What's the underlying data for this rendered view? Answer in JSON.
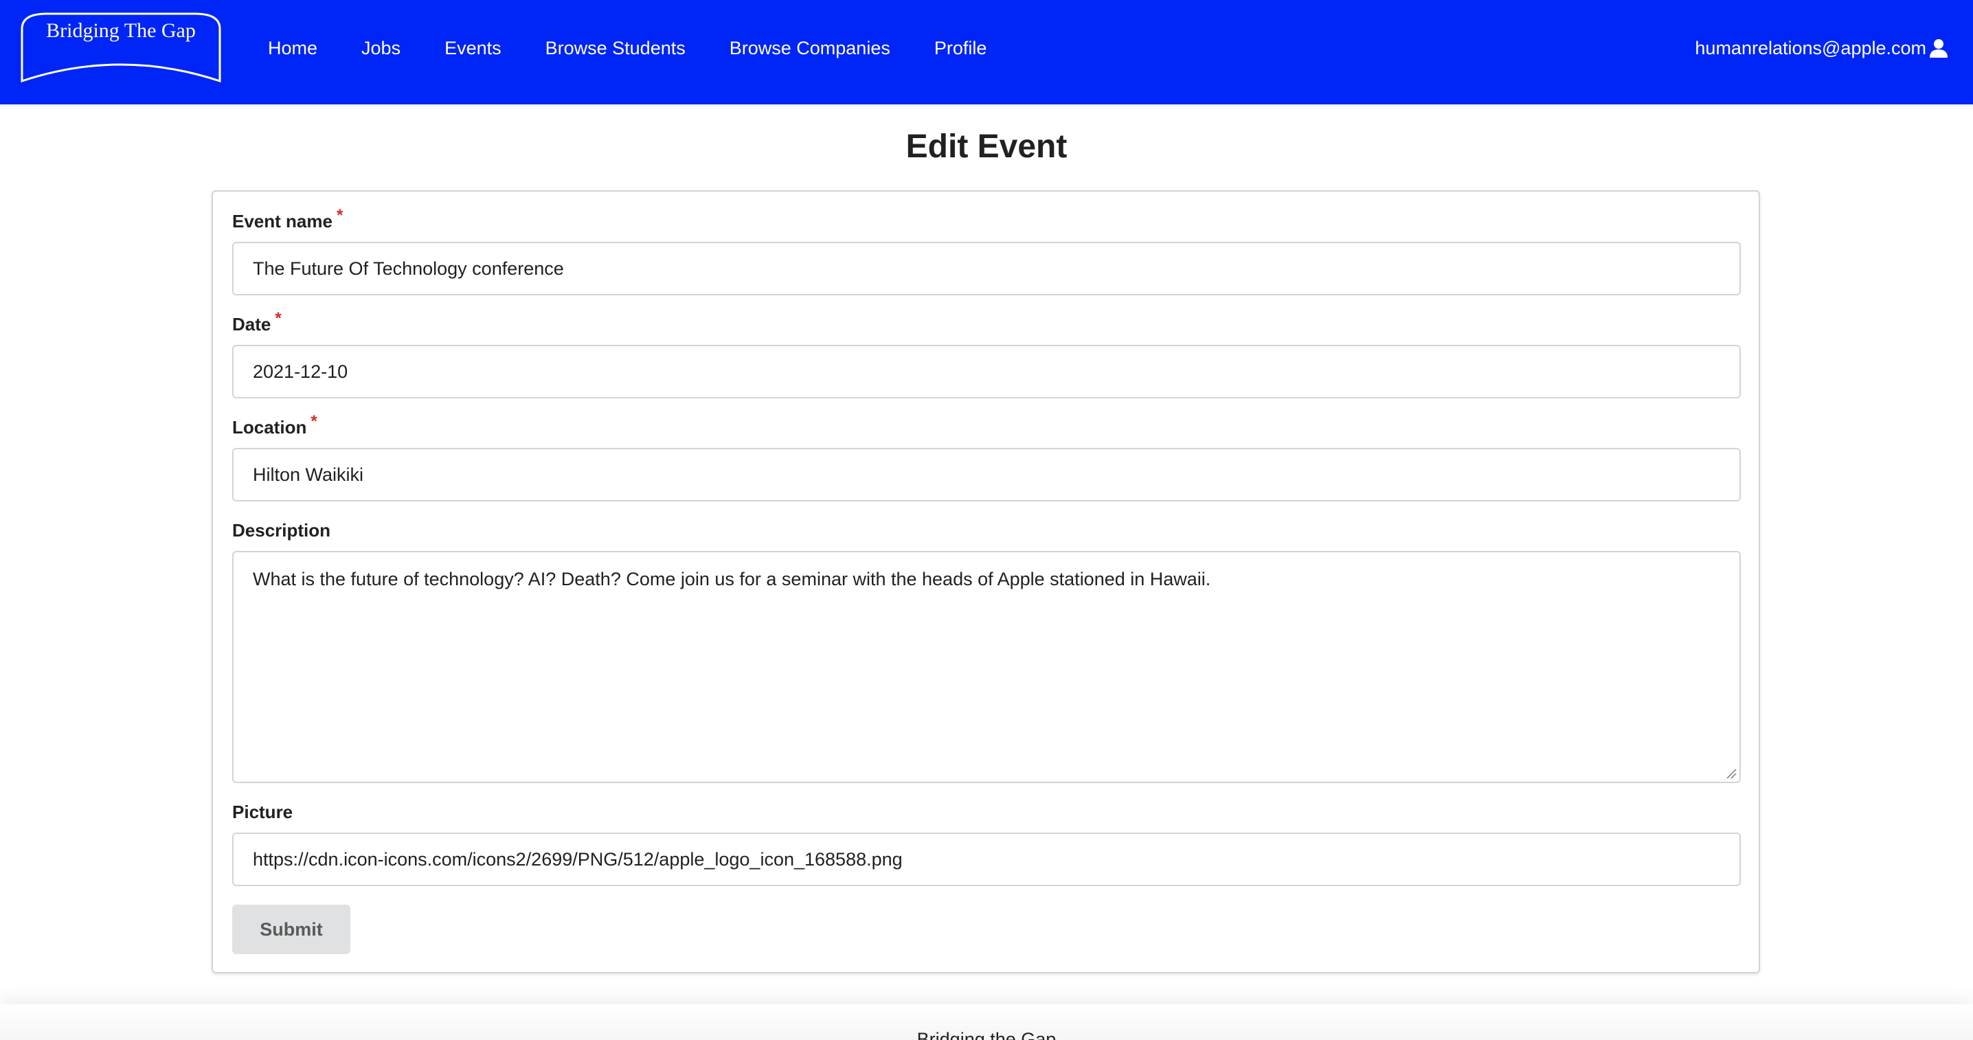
{
  "nav": {
    "logo_text": "Bridging The Gap",
    "links": [
      "Home",
      "Jobs",
      "Events",
      "Browse Students",
      "Browse Companies",
      "Profile"
    ],
    "user_email": "humanrelations@apple.com",
    "user_icon": "user-icon",
    "bg_color": "#0025f7"
  },
  "page": {
    "title": "Edit Event"
  },
  "form": {
    "event_name": {
      "label": "Event name",
      "value": "The Future Of Technology conference",
      "required": true
    },
    "date": {
      "label": "Date",
      "value": "2021-12-10",
      "required": true
    },
    "location": {
      "label": "Location",
      "value": "Hilton Waikiki",
      "required": true
    },
    "description": {
      "label": "Description",
      "value": "What is the future of technology? AI? Death? Come join us for a seminar with the heads of Apple stationed in Hawaii."
    },
    "picture": {
      "label": "Picture",
      "value": "https://cdn.icon-icons.com/icons2/2699/PNG/512/apple_logo_icon_168588.png"
    },
    "required_mark": "*",
    "submit_label": "Submit"
  },
  "footer": {
    "text": "Bridging the Gap"
  }
}
